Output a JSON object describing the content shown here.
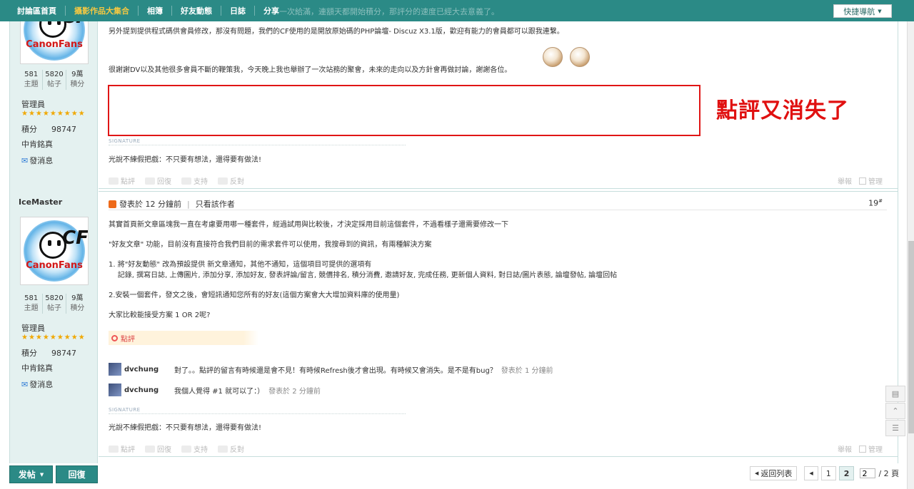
{
  "nav": {
    "items": [
      "討論區首頁",
      "攝影作品大集合",
      "相簿",
      "好友動態",
      "日誌",
      "分享"
    ],
    "active_index": 1,
    "ghost_text": "…一次給滿，連額天都開始積分，那評分的速度已經大去意義了。",
    "quicknav": "快捷導航"
  },
  "post1": {
    "author": {
      "stats": [
        {
          "value": "581",
          "label": "主題"
        },
        {
          "value": "5820",
          "label": "帖子"
        },
        {
          "value": "9萬",
          "label": "積分"
        }
      ],
      "rank": "管理員",
      "stars": "★★★★★★★★★",
      "credit_label": "積分",
      "credit_value": "98747",
      "title": "中肯銘真",
      "message": "發消息"
    },
    "lines": [
      "另外提到提供程式碼供會員修改，那沒有問題，我們的CF使用的是開放原始碼的PHP論壇- Discuz X3.1版，歡迎有能力的會員都可以跟我連繫。",
      "很謝謝DV以及其他很多會員不斷的鞭策我，今天晚上我也舉辦了一次站務的聚會，未來的走向以及方針會再做討論，謝謝各位。"
    ],
    "overlay_text": "點評又消失了",
    "signature_label": "SIGNATURE",
    "signature": "光說不練假把戲：不只要有想法，還得要有做法!",
    "actions": [
      "點評",
      "回復",
      "支持",
      "反對"
    ],
    "actions_right": [
      "舉報",
      "管理"
    ]
  },
  "post2": {
    "author": {
      "name": "IceMaster",
      "stats": [
        {
          "value": "581",
          "label": "主題"
        },
        {
          "value": "5820",
          "label": "帖子"
        },
        {
          "value": "9萬",
          "label": "積分"
        }
      ],
      "rank": "管理員",
      "stars": "★★★★★★★★★",
      "credit_label": "積分",
      "credit_value": "98747",
      "title": "中肯銘真",
      "message": "發消息"
    },
    "posted": "發表於 12 分鐘前",
    "only_author": "只看該作者",
    "floor": "19",
    "floor_sup": "#",
    "lines": [
      "其實首頁新文章區塊我一直在考慮要用哪一種套件，經過試用與比較後，才決定採用目前這個套件，不過看樣子還需要修改一下",
      "\"好友文章\" 功能，目前沒有直接符合我們目前的需求套件可以使用，我搜尋到的資訊，有兩種解決方案",
      "1. 將\"好友動態\" 改為預設提供 新文章通知，其他不通知，這個項目可提供的選項有",
      "    記錄, 撰寫日誌, 上傳圖片, 添加分享, 添加好友, 發表評論/留言, 競價排名, 積分消費, 邀請好友, 完成任務, 更新個人資料, 對日誌/圖片表態, 論壇發帖, 論壇回帖",
      "2.安裝一個套件，發文之後，會短訊通知您所有的好友(這個方案會大大增加資料庫的使用量)",
      "大家比較能接受方案 1 OR 2呢?"
    ],
    "dianping_label": "點評",
    "comments": [
      {
        "name": "dvchung",
        "text": "對了。。點評的留言有時候還是會不見！有時候Refresh後才會出現。有時候又會消失。是不是有bug？",
        "time": "發表於 1 分鐘前"
      },
      {
        "name": "dvchung",
        "text": "我個人覺得 #1 就可以了：）",
        "time": "發表於 2 分鐘前"
      }
    ],
    "signature_label": "SIGNATURE",
    "signature": "光說不練假把戲：不只要有想法，還得要有做法!",
    "actions": [
      "點評",
      "回復",
      "支持",
      "反對"
    ],
    "actions_right": [
      "舉報",
      "管理"
    ]
  },
  "avatar_brand": "CanonFans",
  "avatar_cf": "CF",
  "bottom": {
    "post_button": "发帖",
    "reply_button": "回復",
    "back_list": "返回列表",
    "pages": [
      "1",
      "2"
    ],
    "current_page": "2",
    "page_input": "2",
    "total_pages": "/ 2 頁"
  },
  "colors": {
    "teal": "#2b8a86",
    "sidebar": "#e4f1f0",
    "accent_red": "#e01616",
    "nav_active": "#f5c842"
  }
}
